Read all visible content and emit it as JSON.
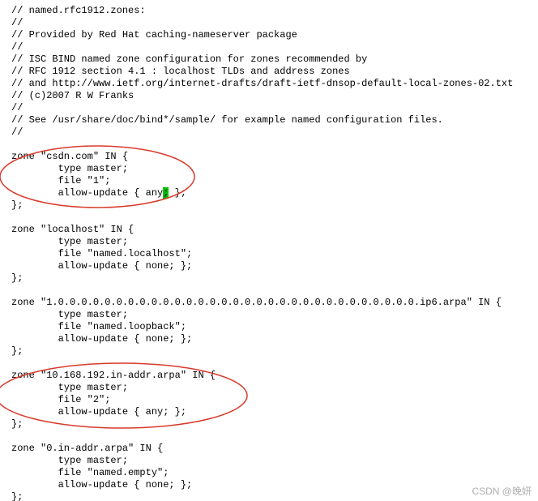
{
  "header_comments": [
    "// named.rfc1912.zones:",
    "//",
    "// Provided by Red Hat caching-nameserver package",
    "//",
    "// ISC BIND named zone configuration for zones recommended by",
    "// RFC 1912 section 4.1 : localhost TLDs and address zones",
    "// and http://www.ietf.org/internet-drafts/draft-ietf-dnsop-default-local-zones-02.txt",
    "// (c)2007 R W Franks",
    "//",
    "// See /usr/share/doc/bind*/sample/ for example named configuration files.",
    "//"
  ],
  "zones": [
    {
      "open": "zone \"csdn.com\" IN {",
      "type": "        type master;",
      "file": "        file \"1\";",
      "allow_pre": "        allow-update { any",
      "cursor": ";",
      "allow_post": " };",
      "close": "};",
      "highlighted": true
    },
    {
      "open": "zone \"localhost\" IN {",
      "type": "        type master;",
      "file": "        file \"named.localhost\";",
      "allow": "        allow-update { none; };",
      "close": "};",
      "highlighted": false
    },
    {
      "open": "zone \"1.0.0.0.0.0.0.0.0.0.0.0.0.0.0.0.0.0.0.0.0.0.0.0.0.0.0.0.0.0.0.0.ip6.arpa\" IN {",
      "type": "        type master;",
      "file": "        file \"named.loopback\";",
      "allow": "        allow-update { none; };",
      "close": "};",
      "highlighted": false
    },
    {
      "open": "zone \"10.168.192.in-addr.arpa\" IN {",
      "type": "        type master;",
      "file": "        file \"2\";",
      "allow": "        allow-update { any; };",
      "close": "};",
      "highlighted": true
    },
    {
      "open": "zone \"0.in-addr.arpa\" IN {",
      "type": "        type master;",
      "file": "        file \"named.empty\";",
      "allow": "        allow-update { none; };",
      "close": "};",
      "highlighted": false
    }
  ],
  "watermark": "CSDN @晚妍",
  "annotation_color": "#d83a2b"
}
